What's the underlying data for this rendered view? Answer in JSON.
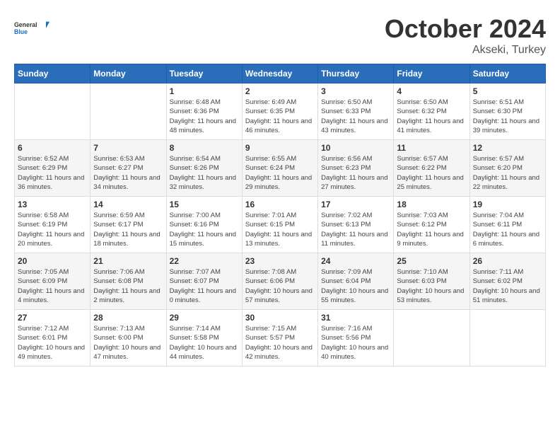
{
  "header": {
    "logo_general": "General",
    "logo_blue": "Blue",
    "month": "October 2024",
    "location": "Akseki, Turkey"
  },
  "days_of_week": [
    "Sunday",
    "Monday",
    "Tuesday",
    "Wednesday",
    "Thursday",
    "Friday",
    "Saturday"
  ],
  "weeks": [
    [
      {
        "day": "",
        "info": ""
      },
      {
        "day": "",
        "info": ""
      },
      {
        "day": "1",
        "info": "Sunrise: 6:48 AM\nSunset: 6:36 PM\nDaylight: 11 hours and 48 minutes."
      },
      {
        "day": "2",
        "info": "Sunrise: 6:49 AM\nSunset: 6:35 PM\nDaylight: 11 hours and 46 minutes."
      },
      {
        "day": "3",
        "info": "Sunrise: 6:50 AM\nSunset: 6:33 PM\nDaylight: 11 hours and 43 minutes."
      },
      {
        "day": "4",
        "info": "Sunrise: 6:50 AM\nSunset: 6:32 PM\nDaylight: 11 hours and 41 minutes."
      },
      {
        "day": "5",
        "info": "Sunrise: 6:51 AM\nSunset: 6:30 PM\nDaylight: 11 hours and 39 minutes."
      }
    ],
    [
      {
        "day": "6",
        "info": "Sunrise: 6:52 AM\nSunset: 6:29 PM\nDaylight: 11 hours and 36 minutes."
      },
      {
        "day": "7",
        "info": "Sunrise: 6:53 AM\nSunset: 6:27 PM\nDaylight: 11 hours and 34 minutes."
      },
      {
        "day": "8",
        "info": "Sunrise: 6:54 AM\nSunset: 6:26 PM\nDaylight: 11 hours and 32 minutes."
      },
      {
        "day": "9",
        "info": "Sunrise: 6:55 AM\nSunset: 6:24 PM\nDaylight: 11 hours and 29 minutes."
      },
      {
        "day": "10",
        "info": "Sunrise: 6:56 AM\nSunset: 6:23 PM\nDaylight: 11 hours and 27 minutes."
      },
      {
        "day": "11",
        "info": "Sunrise: 6:57 AM\nSunset: 6:22 PM\nDaylight: 11 hours and 25 minutes."
      },
      {
        "day": "12",
        "info": "Sunrise: 6:57 AM\nSunset: 6:20 PM\nDaylight: 11 hours and 22 minutes."
      }
    ],
    [
      {
        "day": "13",
        "info": "Sunrise: 6:58 AM\nSunset: 6:19 PM\nDaylight: 11 hours and 20 minutes."
      },
      {
        "day": "14",
        "info": "Sunrise: 6:59 AM\nSunset: 6:17 PM\nDaylight: 11 hours and 18 minutes."
      },
      {
        "day": "15",
        "info": "Sunrise: 7:00 AM\nSunset: 6:16 PM\nDaylight: 11 hours and 15 minutes."
      },
      {
        "day": "16",
        "info": "Sunrise: 7:01 AM\nSunset: 6:15 PM\nDaylight: 11 hours and 13 minutes."
      },
      {
        "day": "17",
        "info": "Sunrise: 7:02 AM\nSunset: 6:13 PM\nDaylight: 11 hours and 11 minutes."
      },
      {
        "day": "18",
        "info": "Sunrise: 7:03 AM\nSunset: 6:12 PM\nDaylight: 11 hours and 9 minutes."
      },
      {
        "day": "19",
        "info": "Sunrise: 7:04 AM\nSunset: 6:11 PM\nDaylight: 11 hours and 6 minutes."
      }
    ],
    [
      {
        "day": "20",
        "info": "Sunrise: 7:05 AM\nSunset: 6:09 PM\nDaylight: 11 hours and 4 minutes."
      },
      {
        "day": "21",
        "info": "Sunrise: 7:06 AM\nSunset: 6:08 PM\nDaylight: 11 hours and 2 minutes."
      },
      {
        "day": "22",
        "info": "Sunrise: 7:07 AM\nSunset: 6:07 PM\nDaylight: 11 hours and 0 minutes."
      },
      {
        "day": "23",
        "info": "Sunrise: 7:08 AM\nSunset: 6:06 PM\nDaylight: 10 hours and 57 minutes."
      },
      {
        "day": "24",
        "info": "Sunrise: 7:09 AM\nSunset: 6:04 PM\nDaylight: 10 hours and 55 minutes."
      },
      {
        "day": "25",
        "info": "Sunrise: 7:10 AM\nSunset: 6:03 PM\nDaylight: 10 hours and 53 minutes."
      },
      {
        "day": "26",
        "info": "Sunrise: 7:11 AM\nSunset: 6:02 PM\nDaylight: 10 hours and 51 minutes."
      }
    ],
    [
      {
        "day": "27",
        "info": "Sunrise: 7:12 AM\nSunset: 6:01 PM\nDaylight: 10 hours and 49 minutes."
      },
      {
        "day": "28",
        "info": "Sunrise: 7:13 AM\nSunset: 6:00 PM\nDaylight: 10 hours and 47 minutes."
      },
      {
        "day": "29",
        "info": "Sunrise: 7:14 AM\nSunset: 5:58 PM\nDaylight: 10 hours and 44 minutes."
      },
      {
        "day": "30",
        "info": "Sunrise: 7:15 AM\nSunset: 5:57 PM\nDaylight: 10 hours and 42 minutes."
      },
      {
        "day": "31",
        "info": "Sunrise: 7:16 AM\nSunset: 5:56 PM\nDaylight: 10 hours and 40 minutes."
      },
      {
        "day": "",
        "info": ""
      },
      {
        "day": "",
        "info": ""
      }
    ]
  ]
}
